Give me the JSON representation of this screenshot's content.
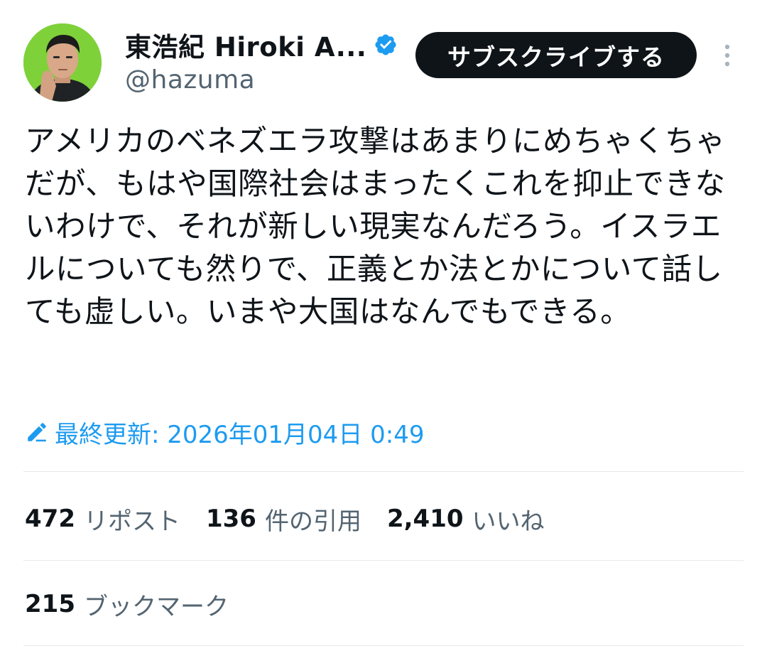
{
  "author": {
    "display_name": "東浩紀 Hiroki A...",
    "handle": "@hazuma",
    "verified": true,
    "avatar_icon": "user-avatar"
  },
  "actions": {
    "subscribe_label": "サブスクライブする",
    "more_icon": "more-vertical-icon"
  },
  "tweet": {
    "text": "アメリカのベネズエラ攻撃はあまりにめちゃくちゃだが、もはや国際社会はまったくこれを抑止できないわけで、それが新しい現実なんだろう。イスラエルについても然りで、正義とか法とかについて話しても虚しい。いまや大国はなんでもできる。",
    "edited_label": "最終更新: 2026年01月04日 0:49"
  },
  "stats": {
    "reposts_count": "472",
    "reposts_label": "リポスト",
    "quotes_count": "136",
    "quotes_label": "件の引用",
    "likes_count": "2,410",
    "likes_label": "いいね",
    "bookmarks_count": "215",
    "bookmarks_label": "ブックマーク"
  },
  "colors": {
    "accent": "#1d9bf0",
    "text_primary": "#0f1419",
    "text_secondary": "#536471",
    "button_bg": "#0f1419",
    "avatar_bg": "#7fd13a"
  }
}
